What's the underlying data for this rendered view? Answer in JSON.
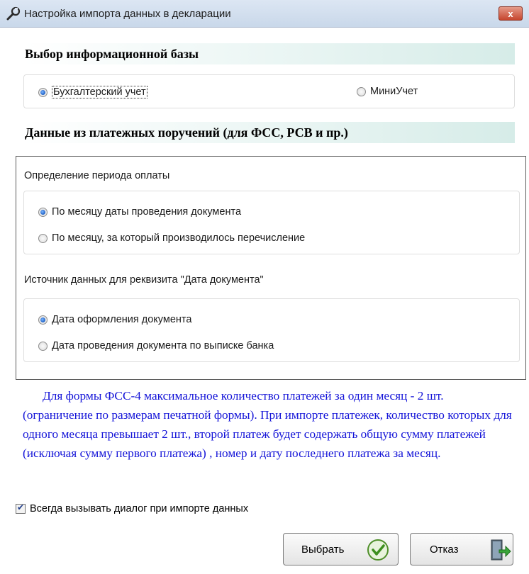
{
  "window": {
    "title": "Настройка импорта данных в декларации",
    "close_label": "x"
  },
  "section1": {
    "header": "Выбор информационной базы",
    "options": [
      {
        "label": "Бухгалтерский учет",
        "checked": true
      },
      {
        "label": "МиниУчет",
        "checked": false
      }
    ]
  },
  "section2": {
    "header": "Данные из платежных поручений (для ФСС, РСВ и пр.)",
    "period": {
      "label": "Определение периода оплаты",
      "options": [
        {
          "label": "По месяцу даты проведения документа",
          "checked": true
        },
        {
          "label": "По месяцу, за который  производилось перечисление",
          "checked": false
        }
      ]
    },
    "source": {
      "label": "Источник данных для реквизита \"Дата документа\"",
      "options": [
        {
          "label": "Дата оформления документа",
          "checked": true
        },
        {
          "label": "Дата проведения документа по выписке банка",
          "checked": false
        }
      ]
    }
  },
  "note": "Для формы ФСС-4 максимальное количество платежей за один месяц - 2 шт. (ограничение по размерам печатной формы). При импорте платежек, количество которых для одного месяца превышает 2 шт., второй платеж будет содержать общую сумму платежей (исключая сумму первого платежа) , номер и дату последнего платежа  за месяц.",
  "always_show_dialog": {
    "label": "Всегда вызывать диалог при импорте данных",
    "checked": true
  },
  "buttons": {
    "select": "Выбрать",
    "cancel": "Отказ"
  },
  "colors": {
    "note_text": "#1414d8",
    "header_bg": "#d6ece8",
    "radio_accent": "#1c5fc4"
  }
}
